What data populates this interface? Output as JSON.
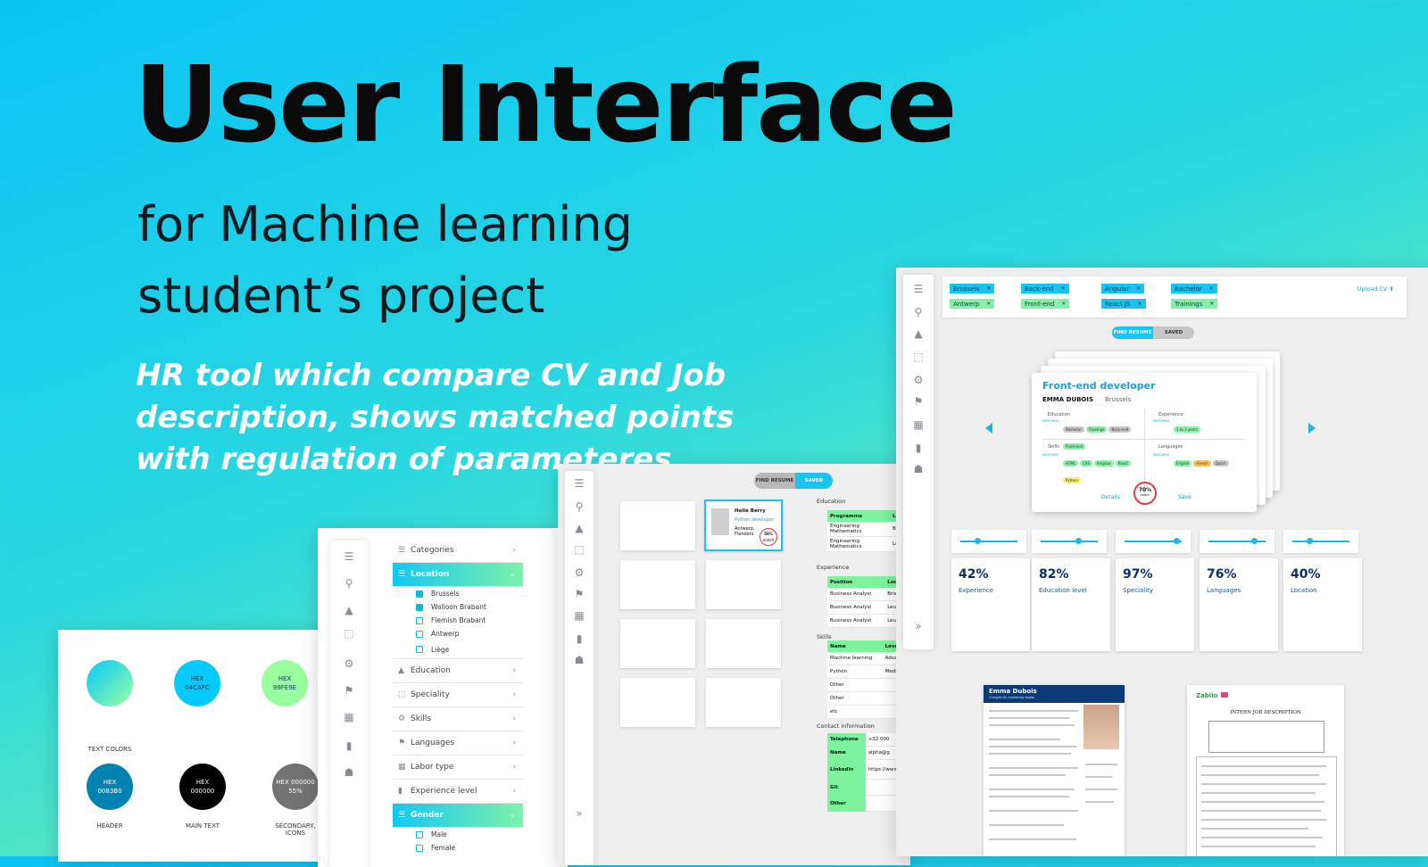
{
  "hero": {
    "title": "User Interface",
    "subtitle_line1": "for Machine learning",
    "subtitle_line2": "student’s project",
    "description": "HR tool which compare CV and Job description, shows matched points with regulation of parameteres"
  },
  "palette": {
    "section_label": "TEXT COLORS",
    "swatches": [
      {
        "hex_label": "HEX",
        "hex_value": "04CAFC",
        "color": "#04CAFC"
      },
      {
        "hex_label": "HEX",
        "hex_value": "99FE9E",
        "color": "#99FE9E"
      },
      {
        "hex_label": "HEX",
        "hex_value": "0083B0",
        "color": "#0083B0",
        "caption": "HEADER"
      },
      {
        "hex_label": "HEX",
        "hex_value": "000000",
        "color": "#000000",
        "caption": "MAIN TEXT"
      },
      {
        "hex_label": "HEX 000000",
        "hex_value": "55%",
        "color": "#737373",
        "caption_line1": "SECONDARY,",
        "caption_line2": "ICONS"
      }
    ]
  },
  "filters": {
    "categories": "Categories",
    "location": "Location",
    "location_options": [
      {
        "label": "Brussels",
        "checked": true
      },
      {
        "label": "Walloon Brabant",
        "checked": true
      },
      {
        "label": "Flemish Brabant",
        "checked": false
      },
      {
        "label": "Antwerp",
        "checked": false
      },
      {
        "label": "Liège",
        "checked": false
      }
    ],
    "items": [
      "Education",
      "Speciality",
      "Skills",
      "Languages",
      "Labor type",
      "Experience level"
    ],
    "gender": "Gender",
    "gender_options": [
      "Male",
      "Female"
    ]
  },
  "saved": {
    "toggle_left": "FIND RESUME",
    "toggle_right": "SAVED",
    "selected_card": {
      "name": "Helle Berry",
      "role": "Python developer",
      "city": "Antwerp,",
      "region": "Flanders",
      "match": "50%",
      "match_sub": "match"
    },
    "education_title": "Education",
    "education_headers": [
      "Programme",
      "Locati"
    ],
    "education_rows": [
      [
        "Engineering Mathematics",
        "Bristol,"
      ],
      [
        "Engineering Mathematics",
        "Leuven"
      ]
    ],
    "experience_title": "Experience",
    "experience_headers": [
      "Position",
      "Locati"
    ],
    "experience_rows": [
      [
        "Business Analyst",
        "Bristol,"
      ],
      [
        "Business Analyst",
        "Leuven"
      ],
      [
        "Business Analyst",
        "Leuven"
      ]
    ],
    "skills_title": "Skills",
    "skills_headers": [
      "Name",
      "Level"
    ],
    "skills_rows": [
      [
        "Machine learning",
        "Advance"
      ],
      [
        "Python",
        "Medium"
      ],
      [
        "Other",
        ""
      ],
      [
        "Other",
        ""
      ],
      [
        "etc",
        ""
      ]
    ],
    "contact_title": "Contact information",
    "contact_rows": [
      [
        "Telephone",
        "+32 000"
      ],
      [
        "Name",
        "alpha@g"
      ],
      [
        "LinkedIn",
        "https://www.lin"
      ],
      [
        "Git",
        ""
      ],
      [
        "Other",
        ""
      ]
    ]
  },
  "main": {
    "chips": [
      {
        "label": "Brussels",
        "tone": "blue"
      },
      {
        "label": "Antwerp",
        "tone": "green"
      },
      {
        "label": "Back-end",
        "tone": "blue"
      },
      {
        "label": "Front-end",
        "tone": "green"
      },
      {
        "label": "Angular",
        "tone": "blue"
      },
      {
        "label": "React JS",
        "tone": "blue"
      },
      {
        "label": "Bachelor",
        "tone": "blue"
      },
      {
        "label": "Trainings",
        "tone": "green"
      }
    ],
    "upload": "Upload CV ⬆",
    "toggle_left": "FIND RESUME",
    "toggle_right": "SAVED",
    "job": {
      "title": "Front-end developer",
      "name": "EMMA DUBOIS",
      "city": "Brussels",
      "education": "Education",
      "experience": "Experience",
      "skills": "Skills",
      "languages": "Languages",
      "matching": "MATCHING",
      "education_pills": [
        "Bachelor",
        "Trainings",
        "Back-end",
        "Front-end"
      ],
      "experience_pills": [
        "1 to 3 years"
      ],
      "skills_pills": [
        "HTML",
        "CSS",
        "Angular",
        "React",
        "Python"
      ],
      "language_pills": [
        "English",
        "French",
        "Dutch"
      ],
      "details": "Details",
      "match": "70%",
      "match_sub": "match",
      "save": "Save"
    },
    "sliders": [
      0.3,
      0.65,
      0.9,
      0.8,
      0.3
    ],
    "stats": [
      {
        "value": "42%",
        "label": "Experience"
      },
      {
        "value": "82%",
        "label": "Education level"
      },
      {
        "value": "97%",
        "label": "Speciality"
      },
      {
        "value": "76%",
        "label": "Languages"
      },
      {
        "value": "40%",
        "label": "Location"
      }
    ],
    "cv_name": "Emma Dubois",
    "cv_sub": "Chargée de marketing digital",
    "job_doc_brand": "Zabilo",
    "job_doc_title": "INTERN JOB DESCRIPTION"
  },
  "colors": {
    "accent": "#13c7f2",
    "accent_green": "#7df2a9",
    "header_blue": "#0083B0"
  }
}
